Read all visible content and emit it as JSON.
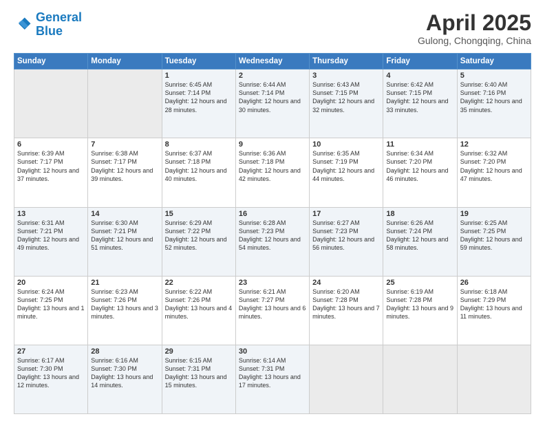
{
  "logo": {
    "line1": "General",
    "line2": "Blue"
  },
  "title": "April 2025",
  "subtitle": "Gulong, Chongqing, China",
  "days_header": [
    "Sunday",
    "Monday",
    "Tuesday",
    "Wednesday",
    "Thursday",
    "Friday",
    "Saturday"
  ],
  "weeks": [
    [
      {
        "num": "",
        "info": ""
      },
      {
        "num": "",
        "info": ""
      },
      {
        "num": "1",
        "info": "Sunrise: 6:45 AM\nSunset: 7:14 PM\nDaylight: 12 hours\nand 28 minutes."
      },
      {
        "num": "2",
        "info": "Sunrise: 6:44 AM\nSunset: 7:14 PM\nDaylight: 12 hours\nand 30 minutes."
      },
      {
        "num": "3",
        "info": "Sunrise: 6:43 AM\nSunset: 7:15 PM\nDaylight: 12 hours\nand 32 minutes."
      },
      {
        "num": "4",
        "info": "Sunrise: 6:42 AM\nSunset: 7:15 PM\nDaylight: 12 hours\nand 33 minutes."
      },
      {
        "num": "5",
        "info": "Sunrise: 6:40 AM\nSunset: 7:16 PM\nDaylight: 12 hours\nand 35 minutes."
      }
    ],
    [
      {
        "num": "6",
        "info": "Sunrise: 6:39 AM\nSunset: 7:17 PM\nDaylight: 12 hours\nand 37 minutes."
      },
      {
        "num": "7",
        "info": "Sunrise: 6:38 AM\nSunset: 7:17 PM\nDaylight: 12 hours\nand 39 minutes."
      },
      {
        "num": "8",
        "info": "Sunrise: 6:37 AM\nSunset: 7:18 PM\nDaylight: 12 hours\nand 40 minutes."
      },
      {
        "num": "9",
        "info": "Sunrise: 6:36 AM\nSunset: 7:18 PM\nDaylight: 12 hours\nand 42 minutes."
      },
      {
        "num": "10",
        "info": "Sunrise: 6:35 AM\nSunset: 7:19 PM\nDaylight: 12 hours\nand 44 minutes."
      },
      {
        "num": "11",
        "info": "Sunrise: 6:34 AM\nSunset: 7:20 PM\nDaylight: 12 hours\nand 46 minutes."
      },
      {
        "num": "12",
        "info": "Sunrise: 6:32 AM\nSunset: 7:20 PM\nDaylight: 12 hours\nand 47 minutes."
      }
    ],
    [
      {
        "num": "13",
        "info": "Sunrise: 6:31 AM\nSunset: 7:21 PM\nDaylight: 12 hours\nand 49 minutes."
      },
      {
        "num": "14",
        "info": "Sunrise: 6:30 AM\nSunset: 7:21 PM\nDaylight: 12 hours\nand 51 minutes."
      },
      {
        "num": "15",
        "info": "Sunrise: 6:29 AM\nSunset: 7:22 PM\nDaylight: 12 hours\nand 52 minutes."
      },
      {
        "num": "16",
        "info": "Sunrise: 6:28 AM\nSunset: 7:23 PM\nDaylight: 12 hours\nand 54 minutes."
      },
      {
        "num": "17",
        "info": "Sunrise: 6:27 AM\nSunset: 7:23 PM\nDaylight: 12 hours\nand 56 minutes."
      },
      {
        "num": "18",
        "info": "Sunrise: 6:26 AM\nSunset: 7:24 PM\nDaylight: 12 hours\nand 58 minutes."
      },
      {
        "num": "19",
        "info": "Sunrise: 6:25 AM\nSunset: 7:25 PM\nDaylight: 12 hours\nand 59 minutes."
      }
    ],
    [
      {
        "num": "20",
        "info": "Sunrise: 6:24 AM\nSunset: 7:25 PM\nDaylight: 13 hours\nand 1 minute."
      },
      {
        "num": "21",
        "info": "Sunrise: 6:23 AM\nSunset: 7:26 PM\nDaylight: 13 hours\nand 3 minutes."
      },
      {
        "num": "22",
        "info": "Sunrise: 6:22 AM\nSunset: 7:26 PM\nDaylight: 13 hours\nand 4 minutes."
      },
      {
        "num": "23",
        "info": "Sunrise: 6:21 AM\nSunset: 7:27 PM\nDaylight: 13 hours\nand 6 minutes."
      },
      {
        "num": "24",
        "info": "Sunrise: 6:20 AM\nSunset: 7:28 PM\nDaylight: 13 hours\nand 7 minutes."
      },
      {
        "num": "25",
        "info": "Sunrise: 6:19 AM\nSunset: 7:28 PM\nDaylight: 13 hours\nand 9 minutes."
      },
      {
        "num": "26",
        "info": "Sunrise: 6:18 AM\nSunset: 7:29 PM\nDaylight: 13 hours\nand 11 minutes."
      }
    ],
    [
      {
        "num": "27",
        "info": "Sunrise: 6:17 AM\nSunset: 7:30 PM\nDaylight: 13 hours\nand 12 minutes."
      },
      {
        "num": "28",
        "info": "Sunrise: 6:16 AM\nSunset: 7:30 PM\nDaylight: 13 hours\nand 14 minutes."
      },
      {
        "num": "29",
        "info": "Sunrise: 6:15 AM\nSunset: 7:31 PM\nDaylight: 13 hours\nand 15 minutes."
      },
      {
        "num": "30",
        "info": "Sunrise: 6:14 AM\nSunset: 7:31 PM\nDaylight: 13 hours\nand 17 minutes."
      },
      {
        "num": "",
        "info": ""
      },
      {
        "num": "",
        "info": ""
      },
      {
        "num": "",
        "info": ""
      }
    ]
  ]
}
